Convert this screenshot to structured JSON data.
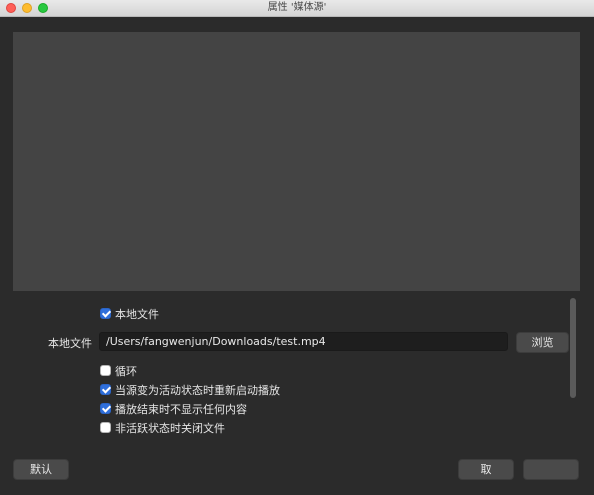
{
  "window": {
    "title": "属性 '媒体源'"
  },
  "options": {
    "local_file_checkbox": {
      "label": "本地文件",
      "checked": true
    },
    "local_file_field": {
      "label": "本地文件",
      "value": "/Users/fangwenjun/Downloads/test.mp4"
    },
    "browse_label": "浏览",
    "loop": {
      "label": "循环",
      "checked": false
    },
    "restart_on_activate": {
      "label": "当源变为活动状态时重新启动播放",
      "checked": true
    },
    "hide_when_ended": {
      "label": "播放结束时不显示任何内容",
      "checked": true
    },
    "close_when_inactive": {
      "label": "非活跃状态时关闭文件",
      "checked": false
    }
  },
  "footer": {
    "defaults_label": "默认",
    "cancel_label": "取",
    "ok_label": ""
  }
}
